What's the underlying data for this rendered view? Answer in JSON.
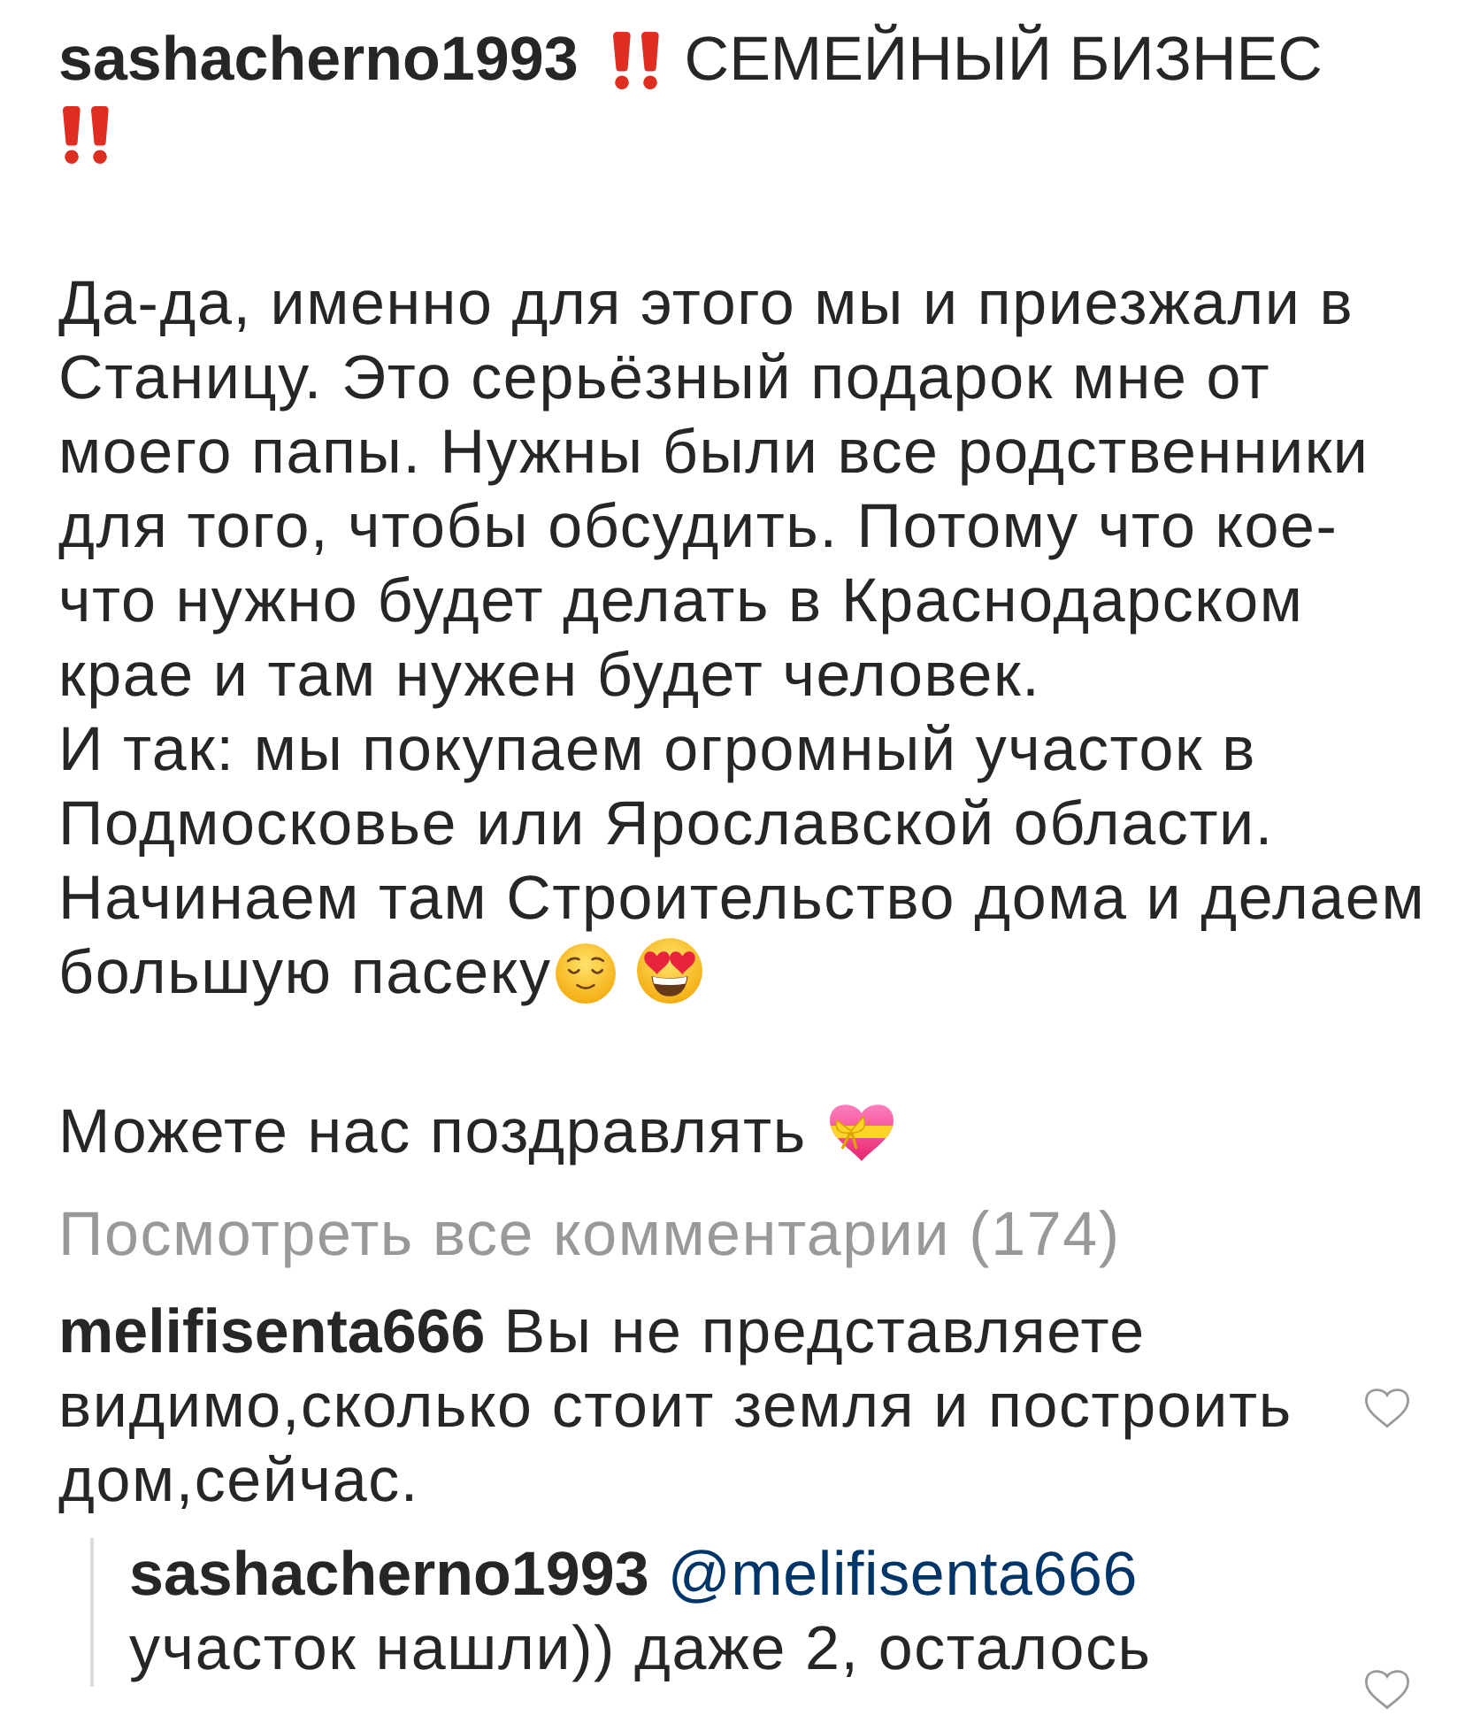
{
  "caption": {
    "username": "sashacherno1993",
    "title": "СЕМЕЙНЫЙ БИЗНЕС",
    "sections": [
      {
        "paragraphs": [
          {
            "kind": "plain",
            "text": "Да-да, именно для этого мы и приезжали в Станицу. Это серьёзный подарок мне от моего папы. Нужны были все родственники для того, чтобы обсудить. Потому что кое-что нужно будет делать в Краснодарском крае и там нужен будет человек."
          },
          {
            "kind": "faces",
            "text": "И так: мы покупаем огромный участок в Подмосковье или Ярославской области. Начинаем там Строительство дома и делаем большую пасеку"
          }
        ]
      },
      {
        "paragraphs": [
          {
            "kind": "gift-heart",
            "text": "Можете нас поздравлять"
          }
        ]
      }
    ]
  },
  "view_all_comments": "Посмотреть все комментарии (174)",
  "comments": [
    {
      "username": "melifisenta666",
      "text": "Вы не представляете видимо,сколько стоит земля и построить дом,сейчас.",
      "liked": false,
      "replies": [
        {
          "username": "sashacherno1993",
          "mention": "@melifisenta666",
          "text": "участок нашли)) даже 2, осталось",
          "liked": false
        }
      ]
    }
  ]
}
